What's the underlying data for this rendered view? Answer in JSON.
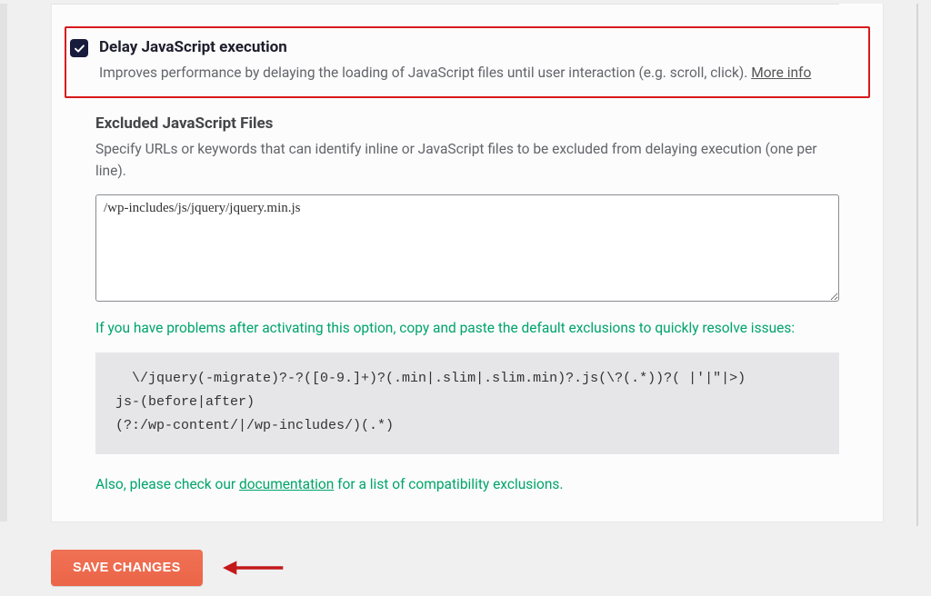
{
  "setting": {
    "title": "Delay JavaScript execution",
    "description_prefix": "Improves performance by delaying the loading of JavaScript files until user interaction (e.g. scroll, click). ",
    "more_info": "More info"
  },
  "excluded": {
    "title": "Excluded JavaScript Files",
    "description": "Specify URLs or keywords that can identify inline or JavaScript files to be excluded from delaying execution (one per line).",
    "textarea_value": "/wp-includes/js/jquery/jquery.min.js"
  },
  "hint": "If you have problems after activating this option, copy and paste the default exclusions to quickly resolve issues:",
  "code": "  \\/jquery(-migrate)?-?([0-9.]+)?(.min|.slim|.slim.min)?.js(\\?(.*))?( |'|\"|>)\njs-(before|after)\n(?:/wp-content/|/wp-includes/)(.*)",
  "doc_line_prefix": "Also, please check our ",
  "doc_link": "documentation",
  "doc_line_suffix": " for a list of compatibility exclusions.",
  "save_label": "SAVE CHANGES"
}
